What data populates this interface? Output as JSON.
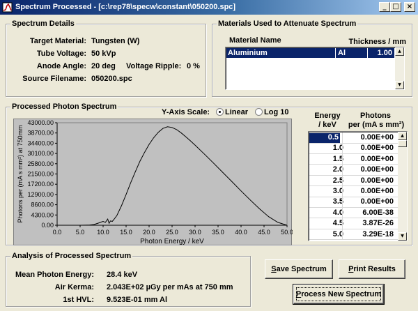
{
  "window": {
    "title": "Spectrum Processed - [c:\\rep78\\specw\\constant\\050200.spc]"
  },
  "spectrum_details": {
    "title": "Spectrum Details",
    "target_material_label": "Target Material:",
    "target_material_value": "Tungsten (W)",
    "tube_voltage_label": "Tube Voltage:",
    "tube_voltage_value": "50 kVp",
    "anode_angle_label": "Anode Angle:",
    "anode_angle_value": "20 deg",
    "voltage_ripple_label": "Voltage Ripple:",
    "voltage_ripple_value": "0 %",
    "source_filename_label": "Source Filename:",
    "source_filename_value": "050200.spc"
  },
  "materials": {
    "title": "Materials Used to Attenuate Spectrum",
    "col_name": "Material Name",
    "col_thickness": "Thickness / mm",
    "rows": [
      {
        "name": "Aluminium",
        "symbol": "Al",
        "thickness": "1.00"
      }
    ]
  },
  "processed": {
    "title": "Processed Photon Spectrum",
    "yscale_label": "Y-Axis Scale:",
    "linear_label": "Linear",
    "log_label": "Log 10",
    "energy_header": "Energy\n/ keV",
    "energy_header_l1": "Energy",
    "energy_header_l2": "/ keV",
    "photons_header_l1": "Photons",
    "photons_header_l2": "per (mA s mm²)",
    "table": [
      {
        "e": "0.5",
        "p": "0.00E+00"
      },
      {
        "e": "1.0",
        "p": "0.00E+00"
      },
      {
        "e": "1.5",
        "p": "0.00E+00"
      },
      {
        "e": "2.0",
        "p": "0.00E+00"
      },
      {
        "e": "2.5",
        "p": "0.00E+00"
      },
      {
        "e": "3.0",
        "p": "0.00E+00"
      },
      {
        "e": "3.5",
        "p": "0.00E+00"
      },
      {
        "e": "4.0",
        "p": "6.00E-38"
      },
      {
        "e": "4.5",
        "p": "3.87E-26"
      },
      {
        "e": "5.0",
        "p": "3.29E-18"
      }
    ]
  },
  "chart_data": {
    "type": "line",
    "title": "",
    "xlabel": "Photon Energy / keV",
    "ylabel": "Photons per (mA s mm²) at 750mm",
    "xlim": [
      0,
      50
    ],
    "ylim": [
      0,
      43000
    ],
    "xticks": [
      "0.0",
      "5.0",
      "10.0",
      "15.0",
      "20.0",
      "25.0",
      "30.0",
      "35.0",
      "40.0",
      "45.0",
      "50.0"
    ],
    "yticks": [
      "43000.00",
      "38700.00",
      "34400.00",
      "30100.00",
      "25800.00",
      "21500.00",
      "17200.00",
      "12900.00",
      "8600.00",
      "4300.00",
      "0.00"
    ],
    "x": [
      0,
      5,
      7,
      8,
      9,
      9.5,
      10,
      10.5,
      11,
      11.3,
      11.6,
      12,
      12.5,
      13,
      14,
      15,
      16,
      17,
      18,
      19,
      20,
      21,
      22,
      23,
      24,
      25,
      26,
      27,
      28,
      29,
      30,
      32,
      34,
      36,
      38,
      40,
      42,
      44,
      46,
      48,
      50
    ],
    "y": [
      0,
      0,
      50,
      300,
      900,
      1300,
      1600,
      1200,
      2600,
      800,
      1800,
      1600,
      2800,
      4100,
      8200,
      12900,
      17800,
      22400,
      26800,
      30500,
      33900,
      36700,
      39000,
      40600,
      41300,
      41000,
      40100,
      38700,
      37100,
      35400,
      33600,
      29900,
      26100,
      22200,
      18300,
      14400,
      10600,
      6900,
      3600,
      1200,
      0
    ]
  },
  "analysis": {
    "title": "Analysis of Processed Spectrum",
    "mean_label": "Mean Photon Energy:",
    "mean_value": "28.4 keV",
    "kerma_label": "Air Kerma:",
    "kerma_value": "2.043E+02 µGy per mAs at 750 mm",
    "hvl_label": "1st HVL:",
    "hvl_value": "9.523E-01 mm Al"
  },
  "buttons": {
    "save_underline": "S",
    "save_rest": "ave Spectrum",
    "print_underline": "P",
    "print_rest": "rint Results",
    "process_underline": "P",
    "process_rest": "rocess New Spectrum"
  }
}
